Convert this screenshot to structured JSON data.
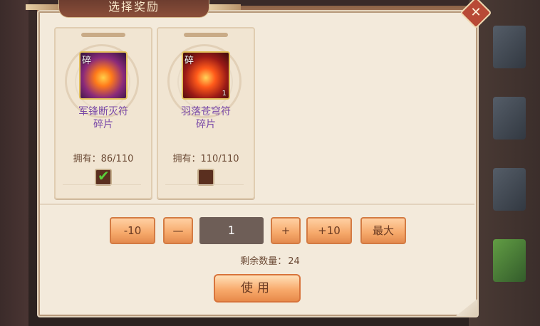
{
  "dialog": {
    "title": "选择奖励",
    "close_label": "✕"
  },
  "cards": [
    {
      "name": "军锋断灭符碎片",
      "name_line1": "军锋断灭符",
      "name_line2": "碎片",
      "frag_badge": "碎",
      "owned_label": "拥有：",
      "owned_value": "86/110",
      "checked": true
    },
    {
      "name": "羽落苍穹符碎片",
      "name_line1": "羽落苍穹符",
      "name_line2": "碎片",
      "frag_badge": "碎",
      "count_badge": "1",
      "owned_label": "拥有：",
      "owned_value": "110/110",
      "checked": false
    }
  ],
  "quantity": {
    "minus10_label": "-10",
    "minus1_label": "—",
    "value": "1",
    "plus1_label": "+",
    "plus10_label": "+10",
    "max_label": "最大"
  },
  "remaining": {
    "label": "剩余数量：",
    "value": "24"
  },
  "use_button_label": "使用",
  "colors": {
    "card_name": "#7a4aa8",
    "button_orange": "#f6a96a",
    "checkbox_fill": "#5a2f1f",
    "check_green": "#5ad03a"
  }
}
